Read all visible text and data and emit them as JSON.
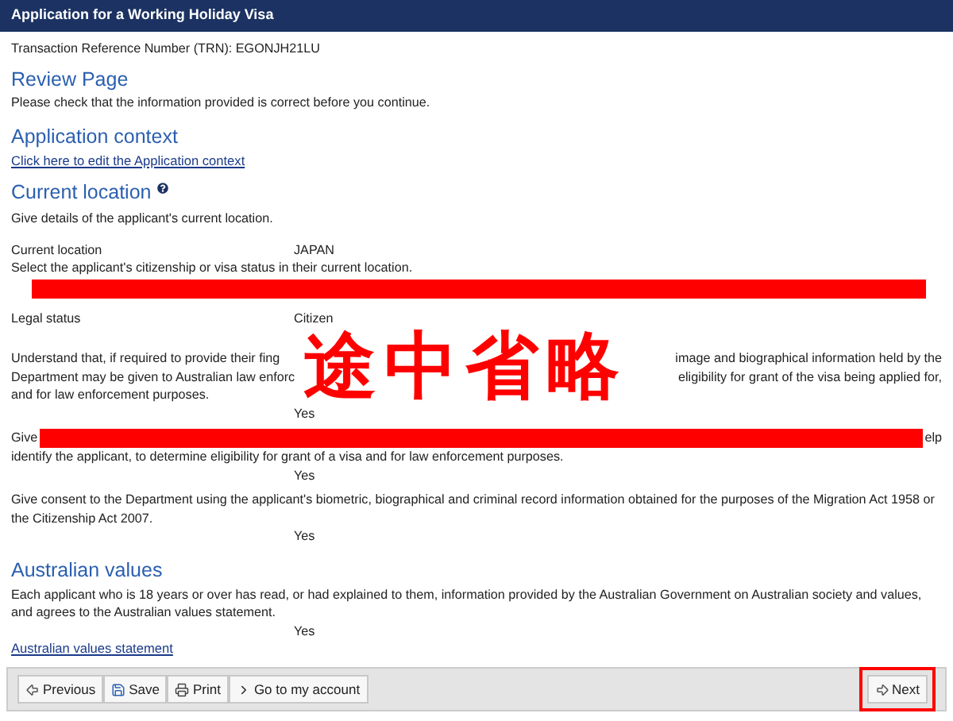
{
  "window": {
    "title": "Application for a Working Holiday Visa"
  },
  "trn": "Transaction Reference Number (TRN): EGONJH21LU",
  "review": {
    "title": "Review Page",
    "text": "Please check that the information provided is correct before you continue."
  },
  "application_context": {
    "title": "Application context",
    "link": "Click here to edit the Application context"
  },
  "current_location": {
    "title": "Current location",
    "intro": "Give details of the applicant's current location.",
    "fields": [
      {
        "label": "Current location",
        "value": "JAPAN",
        "hint": "Select the applicant's citizenship or visa status in their current location.",
        "redacted_after": true
      },
      {
        "label": "Legal status",
        "value": "Citizen",
        "redacted_after": false
      }
    ],
    "declarations": [
      {
        "kind": "stamped",
        "lines": [
          [
            "Understand that, if required to provide their fing",
            "image and biographical information held by the"
          ],
          [
            "Department may be given to Australian law enforc",
            "eligibility for grant of the visa being applied for,"
          ],
          [
            "and for law enforcement purposes."
          ]
        ],
        "answer": "Yes"
      },
      {
        "kind": "redacted",
        "lines": [
          [
            "Give",
            "elp"
          ],
          [
            "identify the applicant, to determine eligibility for grant of a visa and for law enforcement purposes."
          ]
        ],
        "answer": "Yes"
      },
      {
        "kind": "plain",
        "lines": [
          [
            "Give consent to the Department using the applicant's biometric, biographical and criminal record information obtained for the purposes of the Migration Act 1958 or the Citizenship Act 2007."
          ]
        ],
        "answer": "Yes"
      }
    ]
  },
  "australian_values": {
    "title": "Australian values",
    "text": "Each applicant who is 18 years or over has read, or had explained to them, information provided by the Australian Government on Australian society and values, and agrees to the Australian values statement.",
    "answer": "Yes",
    "link": "Australian values statement"
  },
  "toolbar": {
    "buttons": [
      {
        "kind": "previous",
        "label": "Previous"
      },
      {
        "kind": "save",
        "label": "Save"
      },
      {
        "kind": "print",
        "label": "Print"
      },
      {
        "kind": "account",
        "label": "Go to my account"
      }
    ],
    "next": {
      "label": "Next",
      "highlighted": true
    }
  },
  "annotation": {
    "stamp": "途中省略"
  }
}
